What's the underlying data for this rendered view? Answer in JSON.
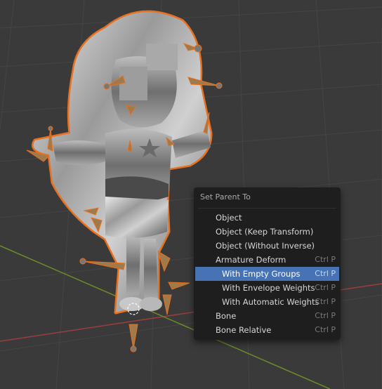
{
  "context_menu": {
    "title": "Set Parent To",
    "items": [
      {
        "label": "Object",
        "shortcut": ""
      },
      {
        "label": "Object (Keep Transform)",
        "shortcut": ""
      },
      {
        "label": "Object (Without Inverse)",
        "shortcut": ""
      },
      {
        "label": "Armature Deform",
        "shortcut": "Ctrl P"
      },
      {
        "label": "With Empty Groups",
        "shortcut": "Ctrl P"
      },
      {
        "label": "With Envelope Weights",
        "shortcut": "Ctrl P"
      },
      {
        "label": "With Automatic Weights",
        "shortcut": "Ctrl P"
      },
      {
        "label": "Bone",
        "shortcut": "Ctrl P"
      },
      {
        "label": "Bone Relative",
        "shortcut": "Ctrl P"
      }
    ],
    "highlighted_item": "With Empty Groups"
  },
  "viewport": {
    "background_color": "#3a3a3a",
    "grid_color": "#454545",
    "x_axis_color": "#9a3e3e",
    "y_axis_color": "#6b8a2a",
    "selection_outline_color": "#e8701e",
    "model_material": "silver"
  }
}
